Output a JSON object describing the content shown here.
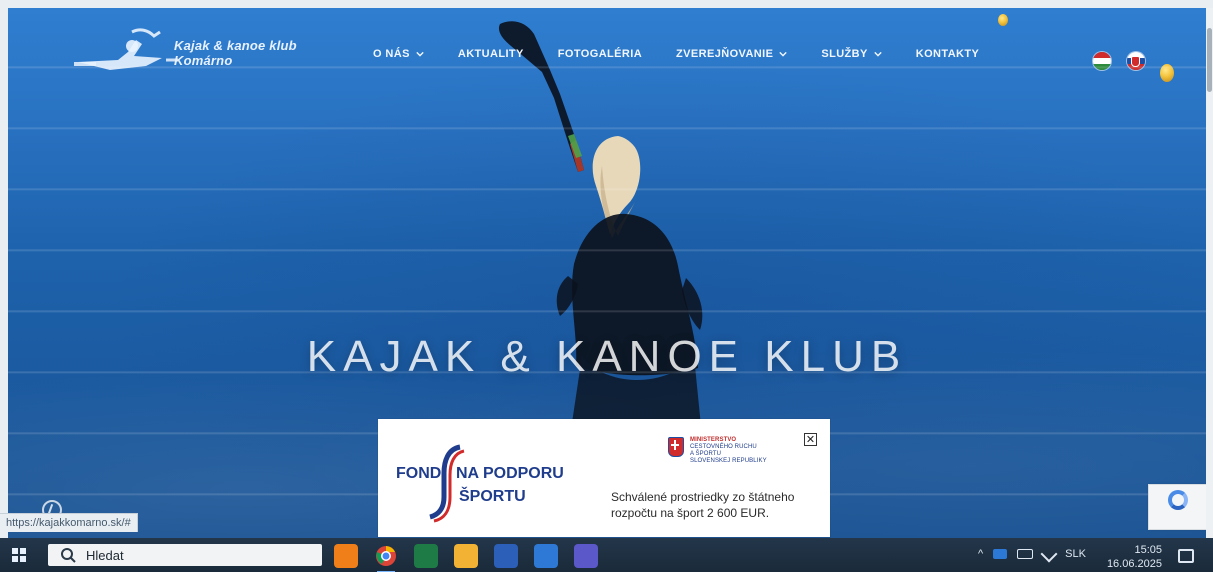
{
  "site": {
    "logo_line1": "Kajak & kanoe klub",
    "logo_line2": "Komárno"
  },
  "nav": {
    "items": [
      {
        "label": "O NÁS",
        "has_dropdown": true
      },
      {
        "label": "AKTUALITY",
        "has_dropdown": false
      },
      {
        "label": "FOTOGALÉRIA",
        "has_dropdown": false
      },
      {
        "label": "ZVEREJŇOVANIE",
        "has_dropdown": true
      },
      {
        "label": "SLUŽBY",
        "has_dropdown": true
      },
      {
        "label": "KONTAKTY",
        "has_dropdown": false
      }
    ],
    "languages": [
      "hu-flag-icon",
      "sk-flag-icon"
    ]
  },
  "hero": {
    "title": "KAJAK & KANOE KLUB"
  },
  "fund_banner": {
    "fond_left": "FOND",
    "fond_right_line1": "NA PODPORU",
    "fond_right_line2": "ŠPORTU",
    "ministry_lines": [
      "MINISTERSTVO",
      "CESTOVNÉHO RUCHU",
      "A ŠPORTU",
      "SLOVENSKEJ REPUBLIKY"
    ],
    "approved_line1": "Schválené prostriedky zo štátneho",
    "approved_line2": "rozpočtu na šport 2 600 EUR.",
    "close_symbol": "✕"
  },
  "browser": {
    "status_url": "https://kajakkomarno.sk/#"
  },
  "taskbar": {
    "search_placeholder": "Hledat",
    "tray_language": "SLK",
    "time": "15:05",
    "date": "16.06.2025"
  },
  "colors": {
    "water_top": "#2f7ed0",
    "water_bottom": "#1a5393",
    "fund_blue": "#1f3d8c",
    "fund_red": "#d12b2b",
    "taskbar_bg": "#1a2a3a"
  }
}
